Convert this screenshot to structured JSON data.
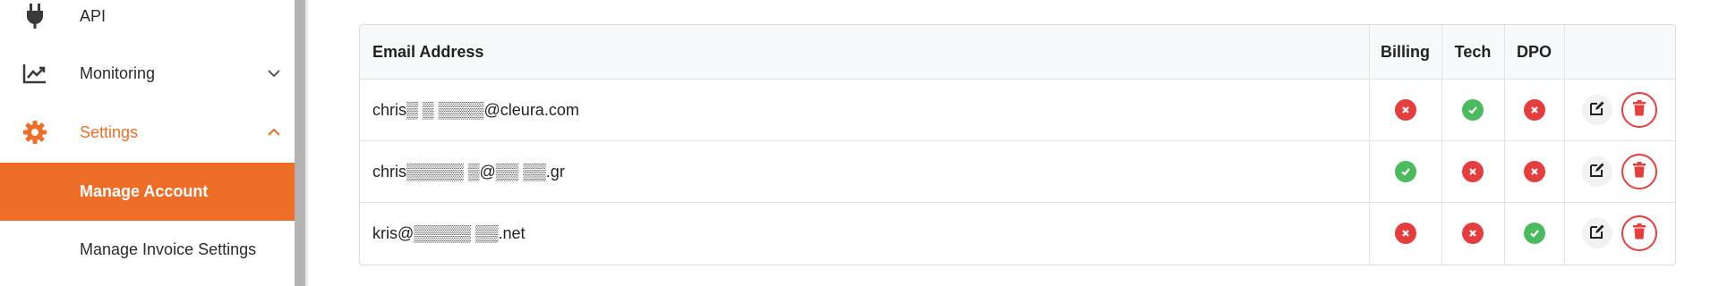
{
  "sidebar": {
    "items": [
      {
        "label": "API",
        "icon": "plug-icon"
      },
      {
        "label": "Monitoring",
        "icon": "chart-line-icon",
        "chevron": "chevron-down-icon"
      },
      {
        "label": "Settings",
        "icon": "gear-icon",
        "chevron": "chevron-up-icon"
      }
    ],
    "subitems": [
      {
        "label": "Manage Account",
        "active": true
      },
      {
        "label": "Manage Invoice Settings",
        "active": false
      }
    ],
    "accent_color": "#ee6e28"
  },
  "table": {
    "headers": {
      "email": "Email Address",
      "billing": "Billing",
      "tech": "Tech",
      "dpo": "DPO",
      "actions": ""
    },
    "rows": [
      {
        "email": "chris▒ ▒ ▒▒▒▒@cleura.com",
        "billing": false,
        "tech": true,
        "dpo": false
      },
      {
        "email": "chris▒▒▒▒▒ ▒@▒▒ ▒▒.gr",
        "billing": true,
        "tech": false,
        "dpo": false
      },
      {
        "email": "kris@▒▒▒▒▒ ▒▒.net",
        "billing": false,
        "tech": false,
        "dpo": true
      }
    ],
    "status_colors": {
      "yes": "#4cbb5f",
      "no": "#e53e3e"
    }
  }
}
